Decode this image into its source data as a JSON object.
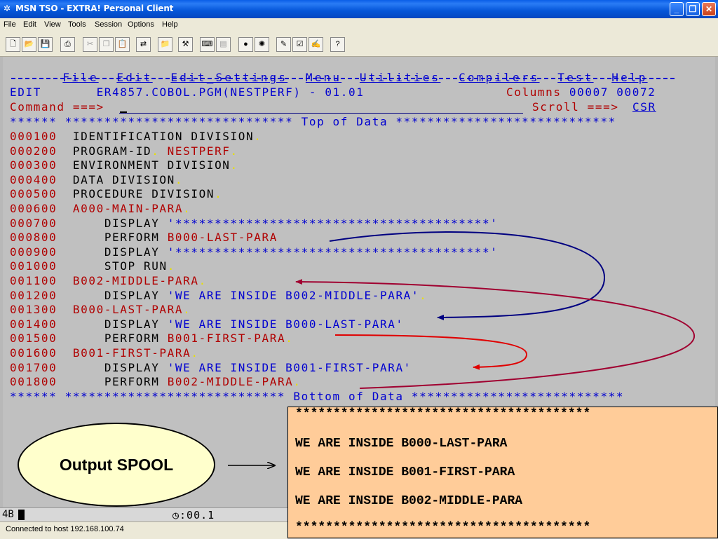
{
  "window": {
    "title": "MSN TSO - EXTRA! Personal Client",
    "controls": [
      "_",
      "❐",
      "✕"
    ]
  },
  "menubar": [
    "File",
    "Edit",
    "View",
    "Tools",
    "Session",
    "Options",
    "Help"
  ],
  "ispf_menu": [
    "File",
    "Edit",
    "Edit_Settings",
    "Menu",
    "Utilities",
    "Compilers",
    "Test",
    "Help"
  ],
  "header": {
    "mode": "EDIT",
    "dataset": "ER4857.COBOL.PGM(NESTPERF) - 01.01",
    "columns_label": "Columns",
    "columns_from": "00007",
    "columns_to": "00072",
    "command_label": "Command ===>",
    "scroll_label": "Scroll ===>",
    "scroll_value": "CSR"
  },
  "markers": {
    "top": "****** ***************************** Top of Data ****************************",
    "bottom": "****** **************************** Bottom of Data ***************************"
  },
  "lines": [
    {
      "num": "000100",
      "text": "IDENTIFICATION DIVISION"
    },
    {
      "num": "000200",
      "kw": "PROGRAM-ID",
      "name": "NESTPERF"
    },
    {
      "num": "000300",
      "text": "ENVIRONMENT DIVISION"
    },
    {
      "num": "000400",
      "text": "DATA DIVISION"
    },
    {
      "num": "000500",
      "text": "PROCEDURE DIVISION"
    },
    {
      "num": "000600",
      "para": "A000-MAIN-PARA"
    },
    {
      "num": "000700",
      "kw": "DISPLAY",
      "str": "'****************************************'"
    },
    {
      "num": "000800",
      "kw": "PERFORM",
      "name": "B000-LAST-PARA"
    },
    {
      "num": "000900",
      "kw": "DISPLAY",
      "str": "'****************************************'"
    },
    {
      "num": "001000",
      "text": "STOP RUN"
    },
    {
      "num": "001100",
      "para": "B002-MIDDLE-PARA"
    },
    {
      "num": "001200",
      "kw": "DISPLAY",
      "str": "'WE ARE INSIDE B002-MIDDLE-PARA'"
    },
    {
      "num": "001300",
      "para": "B000-LAST-PARA"
    },
    {
      "num": "001400",
      "kw": "DISPLAY",
      "str": "'WE ARE INSIDE B000-LAST-PARA'"
    },
    {
      "num": "001500",
      "kw": "PERFORM",
      "name": "B001-FIRST-PARA"
    },
    {
      "num": "001600",
      "para": "B001-FIRST-PARA"
    },
    {
      "num": "001700",
      "kw": "DISPLAY",
      "str": "'WE ARE INSIDE B001-FIRST-PARA'"
    },
    {
      "num": "001800",
      "kw": "PERFORM",
      "name": "B002-MIDDLE-PARA"
    }
  ],
  "status": {
    "indicator": "4B",
    "timer": ":00.1",
    "connection": "Connected to host 192.168.100.74"
  },
  "overlay": {
    "bubble_label": "Output SPOOL",
    "spool_lines": [
      "***************************************",
      "WE ARE INSIDE B000-LAST-PARA",
      "WE ARE INSIDE B001-FIRST-PARA",
      "WE ARE INSIDE B002-MIDDLE-PARA",
      "***************************************"
    ]
  },
  "colors": {
    "navy_arrow": "#000080",
    "red_arrow": "#e00000",
    "maroon_arrow": "#a00030",
    "spool_bg": "#ffcc99",
    "bubble_bg": "#ffffcc"
  }
}
